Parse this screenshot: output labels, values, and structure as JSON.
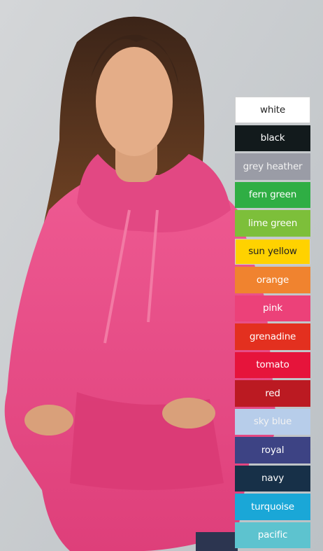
{
  "colors": [
    {
      "label": "white",
      "hex": "#ffffff"
    },
    {
      "label": "black",
      "hex": "#121a1c"
    },
    {
      "label": "grey heather",
      "hex": "#9a9ca6"
    },
    {
      "label": "fern green",
      "hex": "#2fae44"
    },
    {
      "label": "lime green",
      "hex": "#7dbf3a"
    },
    {
      "label": "sun yellow",
      "hex": "#ffd200"
    },
    {
      "label": "orange",
      "hex": "#f0832f"
    },
    {
      "label": "pink",
      "hex": "#ec4179"
    },
    {
      "label": "grenadine",
      "hex": "#e3301f"
    },
    {
      "label": "tomato",
      "hex": "#e6143b"
    },
    {
      "label": "red",
      "hex": "#bb1a22"
    },
    {
      "label": "sky blue",
      "hex": "#b7cdea"
    },
    {
      "label": "royal",
      "hex": "#3d4384"
    },
    {
      "label": "navy",
      "hex": "#173048"
    },
    {
      "label": "turquoise",
      "hex": "#1aa7d7"
    },
    {
      "label": "pacific",
      "hex": "#5dc3cf"
    }
  ],
  "photo": {
    "subject": "model-in-pink-hoodie",
    "garment_color": "#e94a86",
    "background_color": "#c9cdd0"
  }
}
